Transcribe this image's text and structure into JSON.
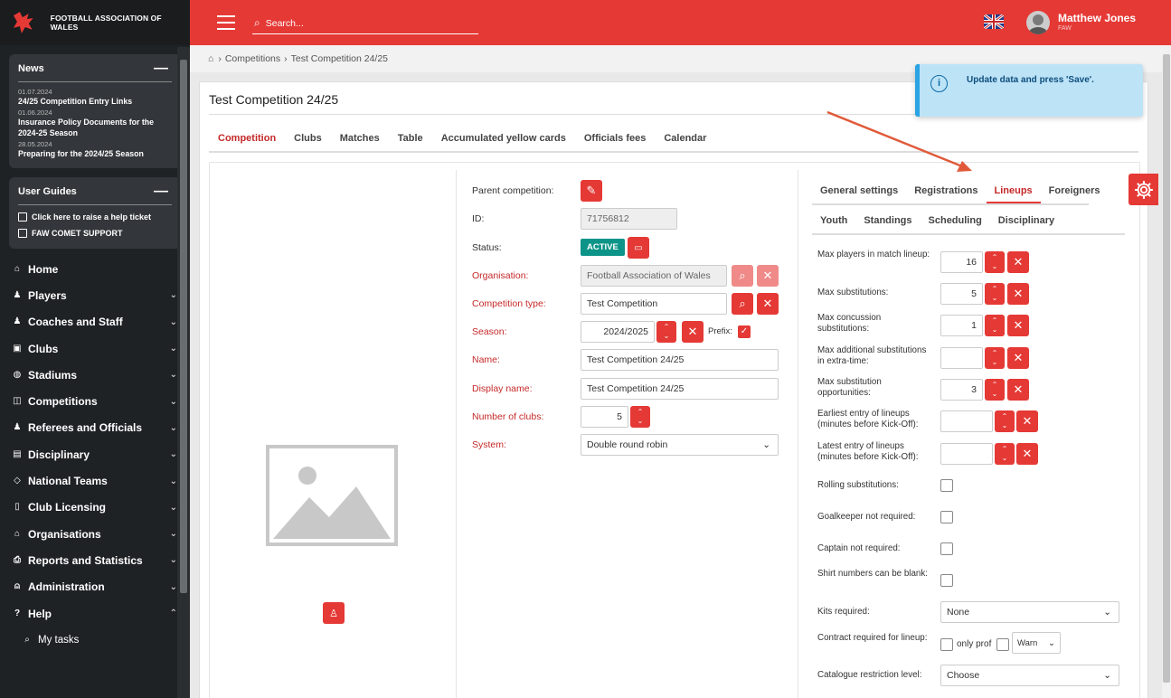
{
  "app": {
    "name": "FOOTBALL ASSOCIATION OF WALES"
  },
  "topbar": {
    "search_placeholder": "Search...",
    "user_name": "Matthew Jones",
    "user_org": "FAW",
    "language_icon": "uk-flag-icon"
  },
  "sidebar": {
    "news": {
      "title": "News",
      "items": [
        {
          "date": "01.07.2024",
          "title": "24/25 Competition Entry Links"
        },
        {
          "date": "01.06.2024",
          "title": "Insurance Policy Documents for the 2024-25 Season"
        },
        {
          "date": "28.05.2024",
          "title": "Preparing for the 2024/25 Season"
        }
      ]
    },
    "guides": {
      "title": "User Guides",
      "items": [
        {
          "label": "Click here to raise a help ticket"
        },
        {
          "label": "FAW COMET SUPPORT"
        }
      ]
    },
    "nav": [
      {
        "label": "Home",
        "icon": "home-icon"
      },
      {
        "label": "Players",
        "icon": "players-icon"
      },
      {
        "label": "Coaches and Staff",
        "icon": "coaches-icon"
      },
      {
        "label": "Clubs",
        "icon": "clubs-icon"
      },
      {
        "label": "Stadiums",
        "icon": "stadium-icon"
      },
      {
        "label": "Competitions",
        "icon": "competitions-icon"
      },
      {
        "label": "Referees and Officials",
        "icon": "referees-icon"
      },
      {
        "label": "Disciplinary",
        "icon": "disciplinary-icon"
      },
      {
        "label": "National Teams",
        "icon": "national-teams-icon"
      },
      {
        "label": "Club Licensing",
        "icon": "licensing-icon"
      },
      {
        "label": "Organisations",
        "icon": "organisations-icon"
      },
      {
        "label": "Reports and Statistics",
        "icon": "reports-icon"
      },
      {
        "label": "Administration",
        "icon": "admin-icon"
      },
      {
        "label": "Help",
        "icon": "help-icon"
      }
    ],
    "sub": {
      "label": "My tasks",
      "icon": "search-icon"
    }
  },
  "breadcrumb": {
    "items": [
      "Competitions",
      "Test Competition 24/25"
    ]
  },
  "page": {
    "title": "Test Competition 24/25",
    "tabs": [
      "Competition",
      "Clubs",
      "Matches",
      "Table",
      "Accumulated yellow cards",
      "Officials fees",
      "Calendar"
    ]
  },
  "form": {
    "parent_label": "Parent competition:",
    "id_label": "ID:",
    "id_value": "71756812",
    "status_label": "Status:",
    "status_value": "ACTIVE",
    "org_label": "Organisation:",
    "org_value": "Football Association of Wales",
    "type_label": "Competition type:",
    "type_value": "Test Competition",
    "season_label": "Season:",
    "season_value": "2024/2025",
    "prefix_label": "Prefix:",
    "name_label": "Name:",
    "name_value": "Test Competition 24/25",
    "display_label": "Display name:",
    "display_value": "Test Competition 24/25",
    "clubs_label": "Number of clubs:",
    "clubs_value": "5",
    "system_label": "System:",
    "system_value": "Double round robin"
  },
  "settings": {
    "tabs_row1": [
      "General settings",
      "Registrations",
      "Lineups",
      "Foreigners"
    ],
    "tabs_row2": [
      "Youth",
      "Standings",
      "Scheduling",
      "Disciplinary"
    ],
    "rows": {
      "max_players": {
        "label": "Max players in match lineup:",
        "value": "16"
      },
      "max_subs": {
        "label": "Max substitutions:",
        "value": "5"
      },
      "max_concussion": {
        "label": "Max concussion substitutions:",
        "value": "1"
      },
      "max_additional": {
        "label": "Max additional substitutions in extra-time:",
        "value": ""
      },
      "max_opps": {
        "label": "Max substitution opportunities:",
        "value": "3"
      },
      "earliest": {
        "label": "Earliest entry of lineups (minutes before Kick-Off):",
        "value": ""
      },
      "latest": {
        "label": "Latest entry of lineups (minutes before Kick-Off):",
        "value": ""
      },
      "rolling": {
        "label": "Rolling substitutions:"
      },
      "gk": {
        "label": "Goalkeeper not required:"
      },
      "captain": {
        "label": "Captain not required:"
      },
      "shirt": {
        "label": "Shirt numbers can be blank:"
      },
      "kits": {
        "label": "Kits required:",
        "value": "None"
      },
      "contract": {
        "label": "Contract required for lineup:",
        "only_prof": "only prof",
        "warn": "Warn"
      },
      "catalogue": {
        "label": "Catalogue restriction level:",
        "value": "Choose"
      }
    }
  },
  "toast": {
    "message": "Update data and press 'Save'."
  },
  "colors": {
    "brand": "#e53935",
    "sidebar": "#1f2225",
    "status": "#0d9488",
    "toast": "#bde3f7"
  }
}
